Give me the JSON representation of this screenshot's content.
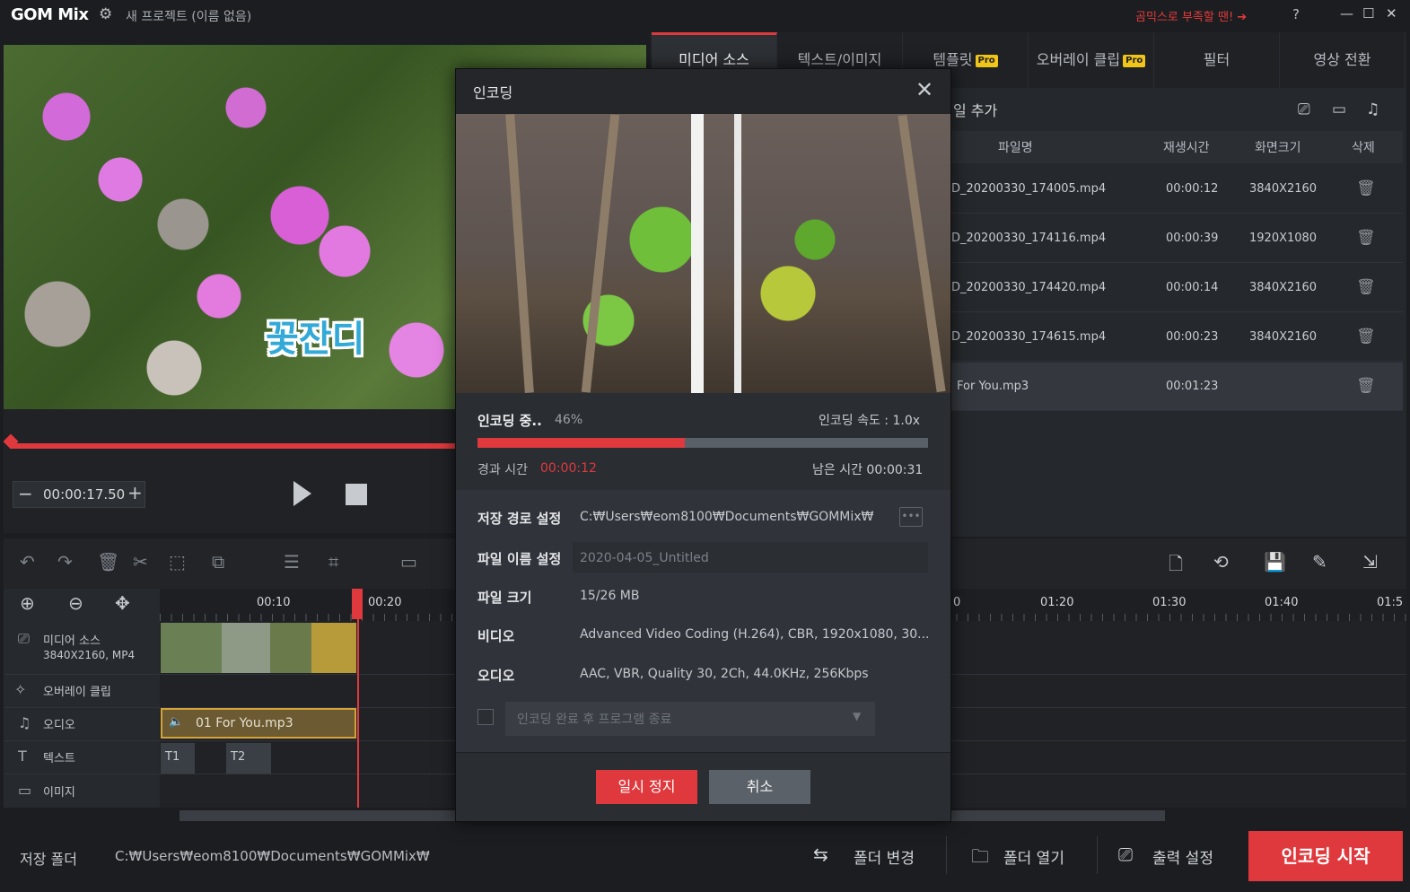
{
  "app": {
    "logo": "GOM Mix",
    "project_title": "새 프로젝트 (이름 없음)",
    "promo": "곰믹스로 부족할 땐! ➔",
    "help": "?",
    "minimize": "—",
    "maximize": "☐",
    "close": "✕"
  },
  "preview": {
    "subtitle_text": "꽃잔디",
    "timecode": "00:00:17.50",
    "minus": "−",
    "plus": "+"
  },
  "tabs": [
    {
      "label": "미디어 소스",
      "active": true,
      "pro": ""
    },
    {
      "label": "텍스트/이미지",
      "active": false,
      "pro": ""
    },
    {
      "label": "템플릿",
      "active": false,
      "pro": "Pro"
    },
    {
      "label": "오버레이 클립",
      "active": false,
      "pro": "Pro"
    },
    {
      "label": "필터",
      "active": false,
      "pro": ""
    },
    {
      "label": "영상 전환",
      "active": false,
      "pro": ""
    }
  ],
  "media": {
    "add_file": "일 추가",
    "columns": {
      "filename": "파일명",
      "duration": "재생시간",
      "resolution": "화면크기",
      "delete": "삭제"
    },
    "rows": [
      {
        "filename": "D_20200330_174005.mp4",
        "duration": "00:00:12",
        "resolution": "3840X2160"
      },
      {
        "filename": "D_20200330_174116.mp4",
        "duration": "00:00:39",
        "resolution": "1920X1080"
      },
      {
        "filename": "D_20200330_174420.mp4",
        "duration": "00:00:14",
        "resolution": "3840X2160"
      },
      {
        "filename": "D_20200330_174615.mp4",
        "duration": "00:00:23",
        "resolution": "3840X2160"
      },
      {
        "filename": "For You.mp3",
        "duration": "00:01:23",
        "resolution": ""
      }
    ]
  },
  "timeline": {
    "ticks": [
      "00:10",
      "00:20",
      "0",
      "01:20",
      "01:30",
      "01:40",
      "01:5"
    ],
    "tracks": [
      {
        "label": "미디어 소스",
        "sub": "3840X2160, MP4"
      },
      {
        "label": "오버레이 클립",
        "sub": ""
      },
      {
        "label": "오디오",
        "sub": ""
      },
      {
        "label": "텍스트",
        "sub": ""
      },
      {
        "label": "이미지",
        "sub": ""
      }
    ],
    "audio_clip": "01 For You.mp3",
    "text_clips": [
      "T1",
      "T2"
    ]
  },
  "bottom": {
    "save_folder_label": "저장 폴더",
    "save_folder_path": "C:₩Users₩eom8100₩Documents₩GOMMix₩",
    "change_folder": "폴더 변경",
    "open_folder": "폴더 열기",
    "output_settings": "출력 설정",
    "start_encoding": "인코딩 시작"
  },
  "dialog": {
    "title": "인코딩",
    "status": "인코딩 중..",
    "percent_text": "46%",
    "progress": 0.46,
    "speed": "인코딩 속도 : 1.0x",
    "elapsed_label": "경과 시간",
    "elapsed_value": "00:00:12",
    "remaining": "남은 시간 00:00:31",
    "save_path_label": "저장 경로 설정",
    "save_path_value": "C:₩Users₩eom8100₩Documents₩GOMMix₩",
    "filename_label": "파일 이름 설정",
    "filename_value": "2020-04-05_Untitled",
    "filesize_label": "파일 크기",
    "filesize_value": "15/26 MB",
    "video_label": "비디오",
    "video_value": "Advanced Video Coding (H.264), CBR, 1920x1080, 30...",
    "audio_label": "오디오",
    "audio_value": "AAC, VBR, Quality 30, 2Ch, 44.0KHz, 256Kbps",
    "after_option": "인코딩 완료 후 프로그램 종료",
    "pause_button": "일시 정지",
    "cancel_button": "취소"
  },
  "colors": {
    "accent": "#e0393d",
    "pro_badge": "#f0c419"
  }
}
